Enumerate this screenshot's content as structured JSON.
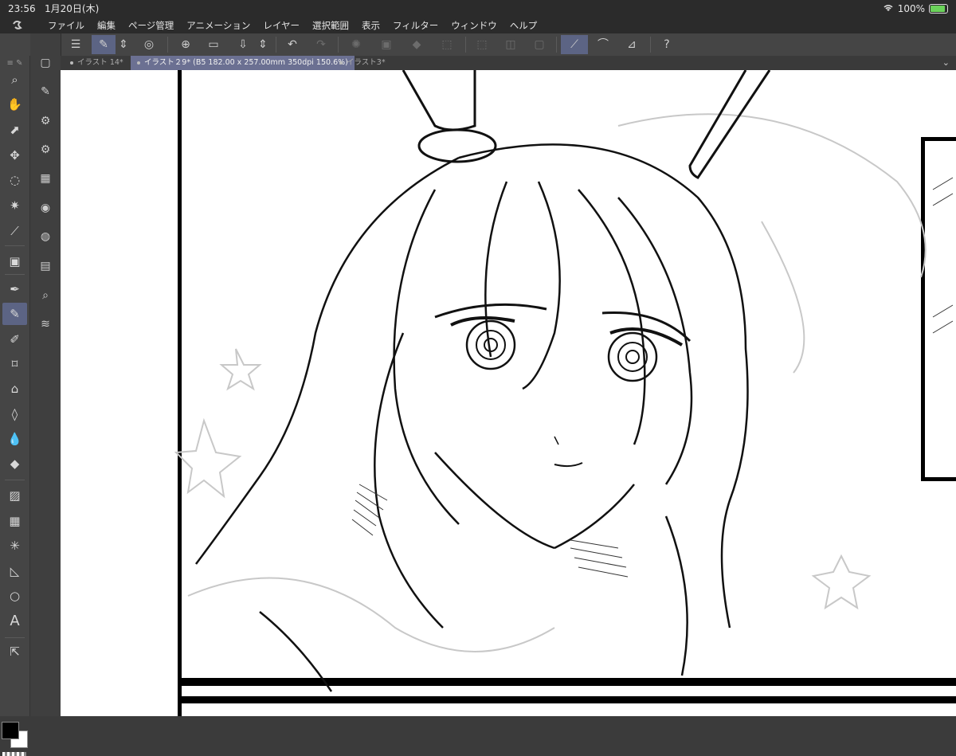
{
  "status_bar": {
    "time": "23:56",
    "date": "1月20日(木)",
    "battery_percent": "100%",
    "battery_level": 1.0,
    "icons": [
      "wifi-icon",
      "battery-charging-icon"
    ]
  },
  "menu": {
    "items": [
      "ファイル",
      "編集",
      "ページ管理",
      "アニメーション",
      "レイヤー",
      "選択範囲",
      "表示",
      "フィルター",
      "ウィンドウ",
      "ヘルプ"
    ]
  },
  "toolbar": {
    "icons": [
      "menu-icon",
      "edit-icon",
      "up-down-icon",
      "spiral-icon",
      "new-file-icon",
      "open-icon",
      "save-icon",
      "up-down-icon",
      "undo-icon",
      "redo-icon",
      "loading-icon",
      "clear-icon",
      "fill-icon",
      "transform-icon",
      "selection-icon",
      "invert-icon",
      "border-icon",
      "snap-ruler-icon",
      "snap-special-icon",
      "snap-grid-icon",
      "help-icon"
    ],
    "accent": "#5c6484"
  },
  "tabs": [
    {
      "label": "イラスト 14*",
      "active": false
    },
    {
      "label": "イラスト２9* (B5 182.00 x 257.00mm 350dpi 150.6%)",
      "active": true
    },
    {
      "label": "イラスト3*",
      "active": false
    }
  ],
  "tools": [
    "zoom-icon",
    "hand-icon",
    "operation-icon",
    "move-icon",
    "lasso-icon",
    "magic-wand-icon",
    "eyedropper-icon",
    "image-icon",
    "pen-icon",
    "pencil-icon",
    "brush-icon",
    "airbrush-icon",
    "decoration-icon",
    "eraser-icon",
    "blend-icon",
    "fill-icon",
    "gradient-icon",
    "frame-icon",
    "ruler-icon",
    "figure-icon",
    "balloon-icon",
    "text-icon",
    "correct-line-icon"
  ],
  "active_tool": "pencil-icon",
  "subtools": [
    "layer-props-icon",
    "sub-tool-icon",
    "sub-tool-detail-icon",
    "tool-props-icon",
    "material-icon",
    "color-icon",
    "history-icon",
    "animation-icon",
    "layer-search-icon",
    "layers-icon"
  ],
  "colors": {
    "main": "#000000",
    "sub": "#ffffff"
  }
}
